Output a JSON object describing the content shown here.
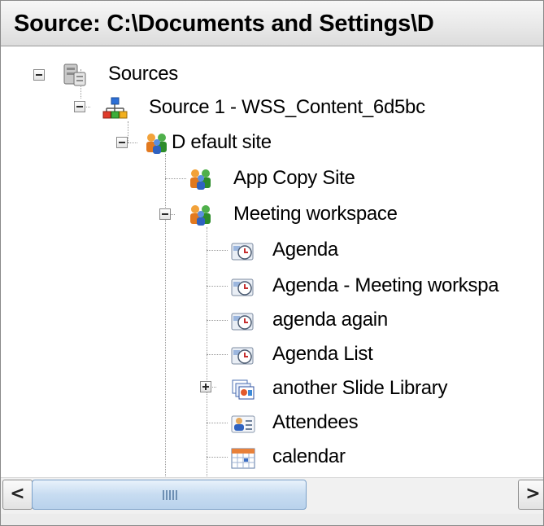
{
  "header": {
    "title": "Source: C:\\Documents and Settings\\D"
  },
  "tree": {
    "root": "Sources",
    "source": "Source 1 - WSS_Content_6d5bc",
    "default_site": "D efault site",
    "app_copy_site": "App Copy Site",
    "meeting_workspace": "Meeting workspace",
    "items": [
      "Agenda",
      "Agenda - Meeting workspa",
      "agenda again",
      "Agenda List",
      "another Slide Library",
      "Attendees",
      "calendar"
    ]
  },
  "scrollbar": {
    "grip": "IIII"
  }
}
